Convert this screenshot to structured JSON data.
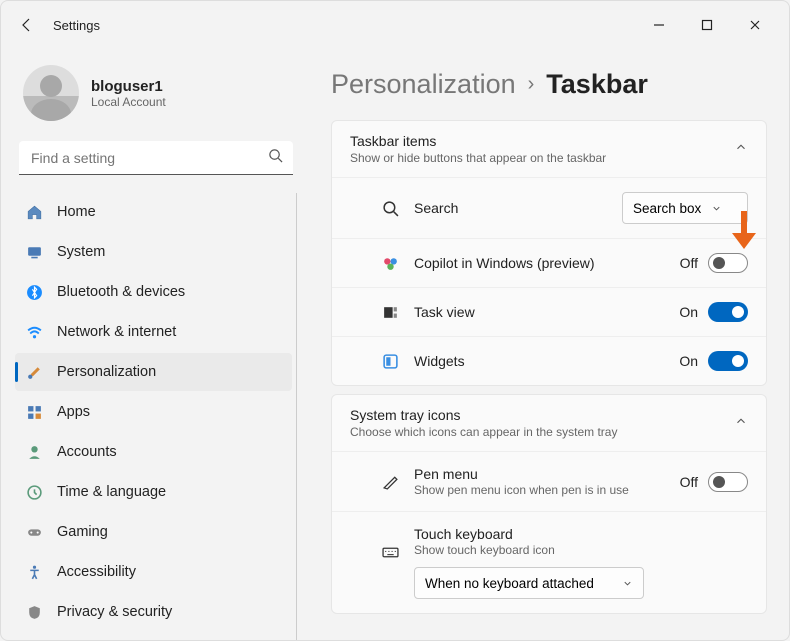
{
  "window": {
    "title": "Settings"
  },
  "profile": {
    "username": "bloguser1",
    "account_type": "Local Account"
  },
  "search": {
    "placeholder": "Find a setting"
  },
  "nav": {
    "items": [
      {
        "label": "Home"
      },
      {
        "label": "System"
      },
      {
        "label": "Bluetooth & devices"
      },
      {
        "label": "Network & internet"
      },
      {
        "label": "Personalization"
      },
      {
        "label": "Apps"
      },
      {
        "label": "Accounts"
      },
      {
        "label": "Time & language"
      },
      {
        "label": "Gaming"
      },
      {
        "label": "Accessibility"
      },
      {
        "label": "Privacy & security"
      }
    ]
  },
  "breadcrumb": {
    "parent": "Personalization",
    "current": "Taskbar"
  },
  "groups": {
    "taskbar_items": {
      "title": "Taskbar items",
      "sub": "Show or hide buttons that appear on the taskbar",
      "rows": {
        "search": {
          "label": "Search",
          "select_value": "Search box"
        },
        "copilot": {
          "label": "Copilot in Windows (preview)",
          "state": "Off"
        },
        "task_view": {
          "label": "Task view",
          "state": "On"
        },
        "widgets": {
          "label": "Widgets",
          "state": "On"
        }
      }
    },
    "system_tray": {
      "title": "System tray icons",
      "sub": "Choose which icons can appear in the system tray",
      "rows": {
        "pen": {
          "label": "Pen menu",
          "sub": "Show pen menu icon when pen is in use",
          "state": "Off"
        },
        "touch_kb": {
          "label": "Touch keyboard",
          "sub": "Show touch keyboard icon",
          "select_value": "When no keyboard attached"
        }
      }
    }
  }
}
